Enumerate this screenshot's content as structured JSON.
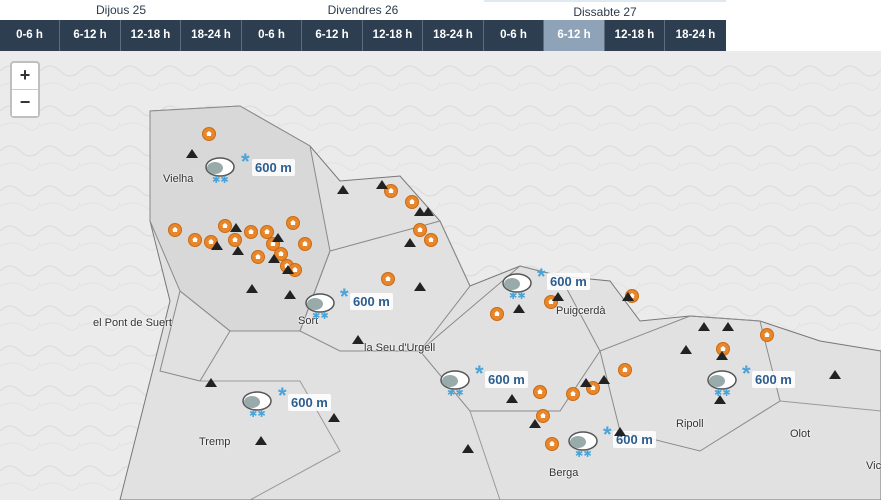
{
  "days": [
    {
      "label": "Dijous 25"
    },
    {
      "label": "Divendres 26"
    },
    {
      "label": "Dissabte 27"
    }
  ],
  "slots": [
    "0-6 h",
    "6-12 h",
    "12-18 h",
    "18-24 h",
    "0-6 h",
    "6-12 h",
    "12-18 h",
    "18-24 h",
    "0-6 h",
    "6-12 h",
    "12-18 h",
    "18-24 h"
  ],
  "selected_slot": 9,
  "zoom": {
    "in": "+",
    "out": "−"
  },
  "towns": [
    "Vielha",
    "el Pont de Suert",
    "Sort",
    "la Seu d'Urgell",
    "Puigcerdà",
    "Tremp",
    "Ripoll",
    "Olot",
    "Berga",
    "Vic"
  ],
  "snow_labels": [
    "600 m",
    "600 m",
    "600 m",
    "600 m",
    "600 m",
    "600 m",
    "600 m"
  ],
  "colors": {
    "bar": "#2c3e50",
    "selected": "#8fa3b8",
    "hut": "#e8862b",
    "snow": "#4aa3d9"
  },
  "icons": {
    "hut": "refuge-icon",
    "peak": "peak-icon",
    "snow": "snow-cloud-icon"
  }
}
